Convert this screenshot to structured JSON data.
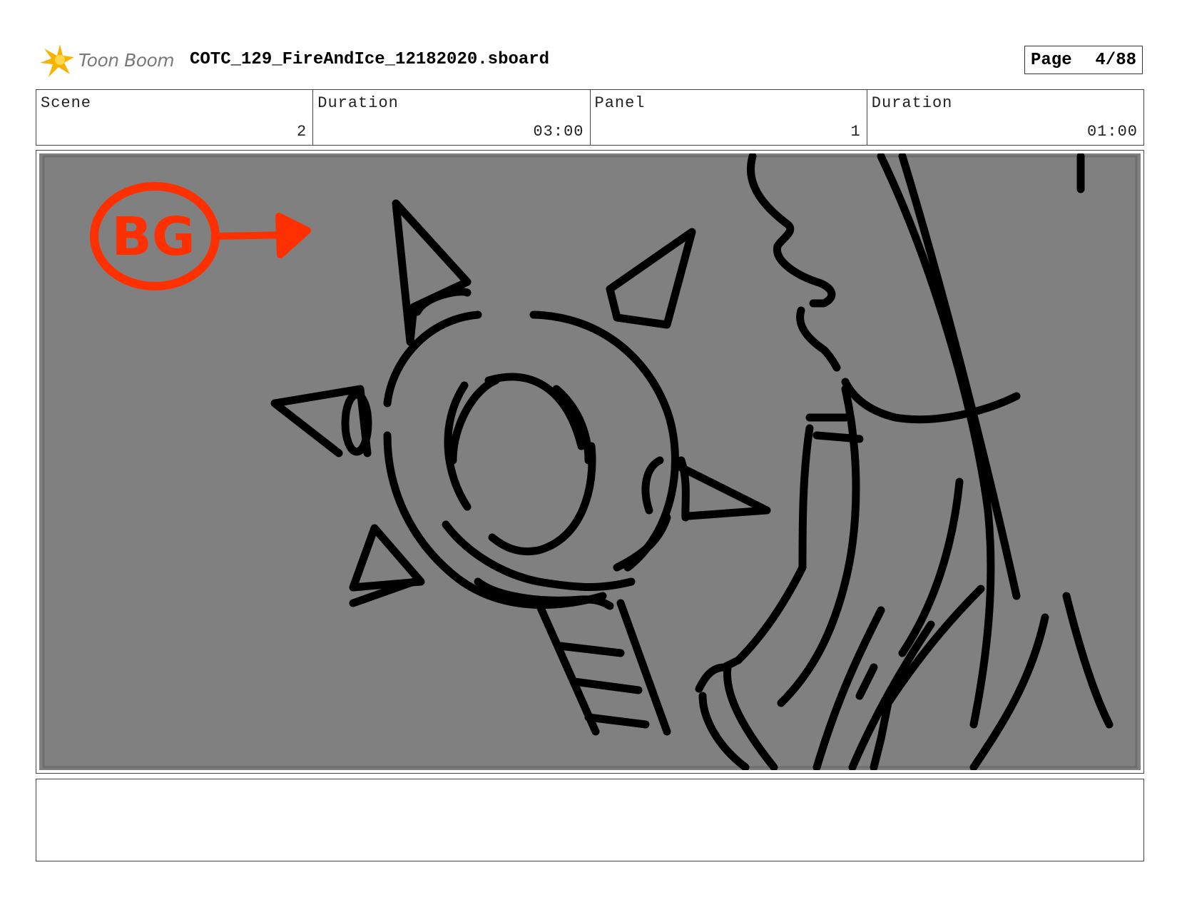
{
  "header": {
    "logo_text": "Toon Boom",
    "file_name": "COTC_129_FireAndIce_12182020.sboard",
    "page_label": "Page",
    "page_value": "4/88"
  },
  "info": {
    "scene_label": "Scene",
    "scene_value": "2",
    "scene_duration_label": "Duration",
    "scene_duration_value": "03:00",
    "panel_label": "Panel",
    "panel_value": "1",
    "panel_duration_label": "Duration",
    "panel_duration_value": "01:00"
  },
  "panel": {
    "annotation": "BG",
    "background_color": "#808080",
    "annotation_color": "#ff3000",
    "line_color": "#000000"
  },
  "notes": {
    "text": ""
  }
}
